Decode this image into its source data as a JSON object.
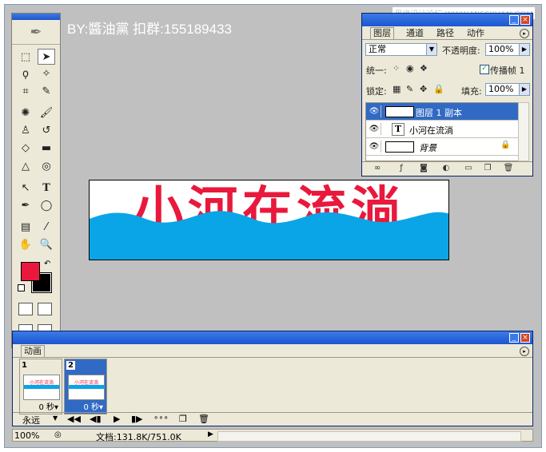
{
  "watermark": "BY:醬油黨 扣群:155189433",
  "site": "思缘设计论坛 WWW.MISSYUAN.COM",
  "colors": {
    "foreground": "#e8193c",
    "background": "#000000",
    "water": "#0aa5e6",
    "title_blue": "#1b56d1"
  },
  "canvas": {
    "text": "小河在流淌"
  },
  "layers_panel": {
    "tabs": [
      "图层",
      "通道",
      "路径",
      "动作"
    ],
    "blend_mode": "正常",
    "opacity_label": "不透明度:",
    "opacity_value": "100%",
    "unify_label": "统一:",
    "propagate_label": "传播帧 1",
    "propagate_checked": true,
    "lock_label": "锁定:",
    "fill_label": "填充:",
    "fill_value": "100%",
    "layers": [
      {
        "name": "图层 1 副本",
        "selected": true,
        "thumb": "icon-thumb"
      },
      {
        "name": "小河在流淌",
        "selected": false,
        "thumb": "text-icon",
        "thumb_text": "T"
      },
      {
        "name": "背景",
        "selected": false,
        "thumb": "white-thumb",
        "locked": true
      }
    ]
  },
  "animation_panel": {
    "tab": "动画",
    "frames": [
      {
        "number": "1",
        "delay": "0 秒▾",
        "selected": false,
        "thumb_text": "小河在流淌"
      },
      {
        "number": "2",
        "delay": "0 秒▾",
        "selected": true,
        "thumb_text": "小河在流淌"
      }
    ],
    "loop": "永远"
  },
  "status": {
    "zoom": "100%",
    "doc": "文档:131.8K/751.0K"
  }
}
